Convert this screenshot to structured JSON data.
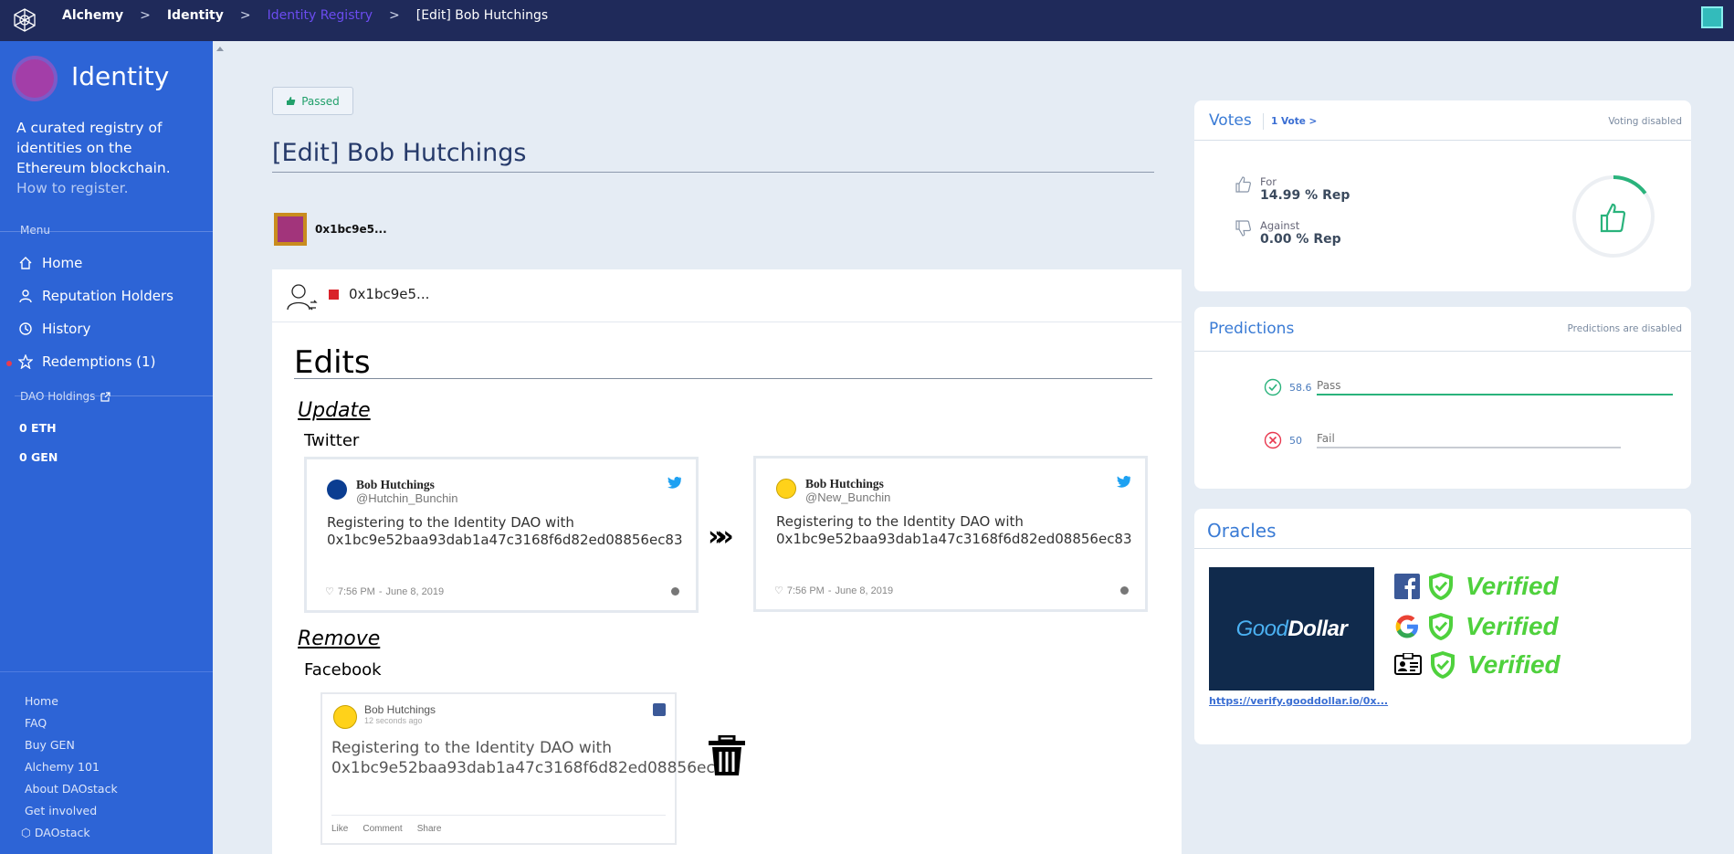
{
  "topbar": {
    "crumbs": [
      "Alchemy",
      "Identity",
      "Identity Registry",
      "[Edit] Bob Hutchings"
    ],
    "separator": ">"
  },
  "sidebar": {
    "title": "Identity",
    "description": "A curated registry of identities on the Ethereum blockchain.",
    "register_link": "How to register.",
    "menu_label": "Menu",
    "items": [
      {
        "label": "Home",
        "icon": "home-icon"
      },
      {
        "label": "Reputation Holders",
        "icon": "user-icon"
      },
      {
        "label": "History",
        "icon": "history-icon"
      },
      {
        "label": "Redemptions (1)",
        "icon": "star-icon"
      }
    ],
    "holdings_label": "DAO Holdings",
    "holdings": [
      "0 ETH",
      "0 GEN"
    ],
    "footer": [
      "Home",
      "FAQ",
      "Buy GEN",
      "Alchemy 101",
      "About DAOstack",
      "Get involved",
      "DAOstack"
    ]
  },
  "proposal": {
    "status": "Passed",
    "title": "[Edit] Bob Hutchings",
    "proposer": "0x1bc9e5...",
    "beneficiary": "0x1bc9e5..."
  },
  "edits": {
    "title": "Edits",
    "update_label": "Update",
    "twitter_label": "Twitter",
    "old_tweet": {
      "name": "Bob Hutchings",
      "handle": "@Hutchin_Bunchin",
      "text": "Registering to the Identity DAO with 0x1bc9e52baa93dab1a47c3168f6d82ed08856ec83",
      "time": "7:56 PM",
      "date": "June 8, 2019"
    },
    "new_tweet": {
      "name": "Bob Hutchings",
      "handle": "@New_Bunchin",
      "text": "Registering to the Identity DAO with 0x1bc9e52baa93dab1a47c3168f6d82ed08856ec83",
      "time": "7:56 PM",
      "date": "June 8, 2019"
    },
    "arrows": "»»",
    "remove_label": "Remove",
    "facebook_label": "Facebook",
    "fb_post": {
      "name": "Bob Hutchings",
      "time": "12 seconds ago",
      "text": "Registering to the Identity DAO with 0x1bc9e52baa93dab1a47c3168f6d82ed08856ec83",
      "actions": [
        "Like",
        "Comment",
        "Share"
      ]
    }
  },
  "votes": {
    "title": "Votes",
    "count_link": "1 Vote >",
    "note": "Voting disabled",
    "for_label": "For",
    "for_value": "14.99 %",
    "for_unit": "Rep",
    "against_label": "Against",
    "against_value": "0.00 %",
    "against_unit": "Rep",
    "gauge_fraction": 0.1499
  },
  "predictions": {
    "title": "Predictions",
    "note": "Predictions are disabled",
    "pass_amount": "58.6",
    "pass_placeholder": "Pass",
    "fail_amount": "50",
    "fail_placeholder": "Fail"
  },
  "oracles": {
    "title": "Oracles",
    "brand_a": "Good",
    "brand_b": "Dollar",
    "link": "https://verify.gooddollar.io/0x...",
    "verified": [
      "Verified",
      "Verified",
      "Verified"
    ],
    "providers": [
      "facebook-icon",
      "google-icon",
      "id-card-icon"
    ]
  },
  "colors": {
    "sidebar": "#2d64d6",
    "topbar": "#1f2a5a",
    "pass": "#22a06b",
    "verified": "#4fd13d"
  }
}
